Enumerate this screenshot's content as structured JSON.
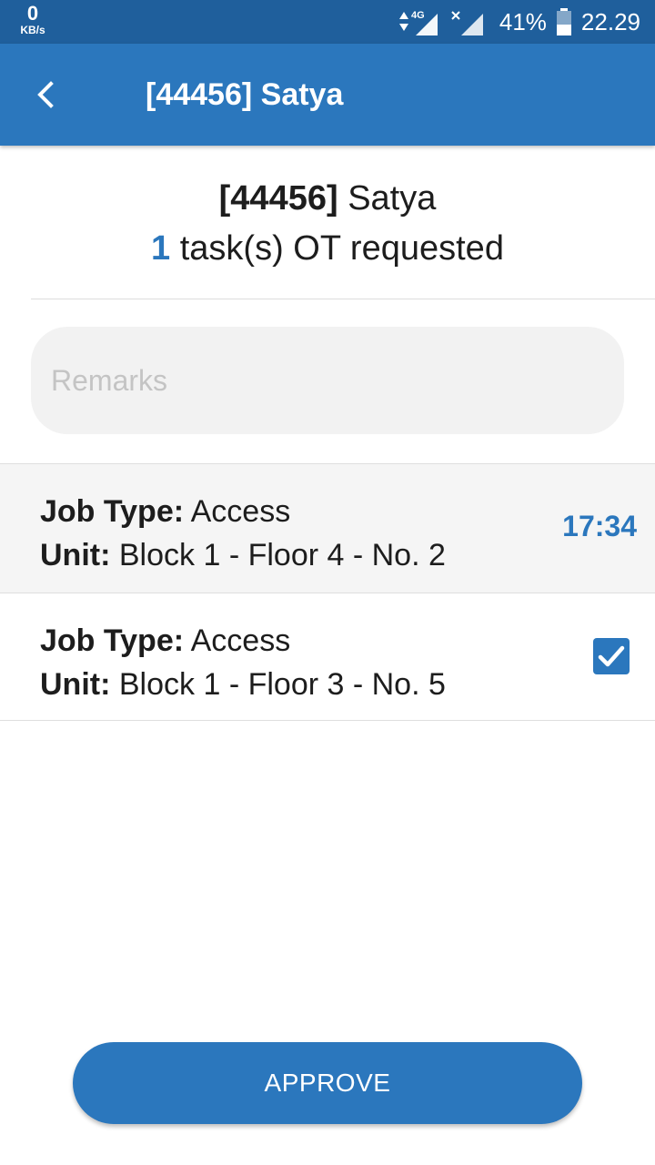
{
  "status_bar": {
    "net_speed": "0",
    "net_unit": "KB/s",
    "network_type": "4G",
    "battery": "41%",
    "time": "22.29"
  },
  "appbar": {
    "title": "[44456] Satya",
    "back_icon": "chevron-left-icon"
  },
  "header": {
    "employee_id": "[44456]",
    "employee_name": "Satya",
    "task_count": "1",
    "task_text": "task(s) OT requested"
  },
  "remarks": {
    "value": "",
    "placeholder": "Remarks"
  },
  "tasks": [
    {
      "job_type_label": "Job Type:",
      "job_type": "Access",
      "unit_label": "Unit:",
      "unit": "Block 1 - Floor 4 - No. 2",
      "time": "17:34",
      "checked": false
    },
    {
      "job_type_label": "Job Type:",
      "job_type": "Access",
      "unit_label": "Unit:",
      "unit": "Block 1 - Floor 3 - No. 5",
      "checked": true
    }
  ],
  "actions": {
    "approve_label": "APPROVE"
  },
  "colors": {
    "status_bar": "#1f5f9c",
    "primary": "#2b77bd",
    "row_highlight": "#f5f5f5"
  }
}
